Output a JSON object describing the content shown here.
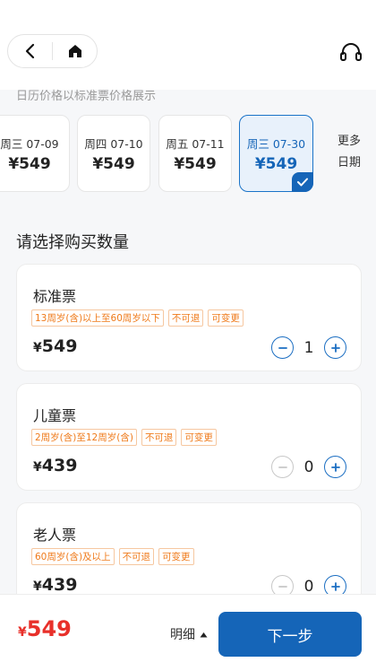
{
  "nav": {
    "back_icon": "chevron-left-icon",
    "home_icon": "home-icon",
    "service_icon": "headset-icon"
  },
  "hint": "日历价格以标准票价格展示",
  "dates": [
    {
      "day": "周三 07-09",
      "price": "¥549",
      "selected": false
    },
    {
      "day": "周四 07-10",
      "price": "¥549",
      "selected": false
    },
    {
      "day": "周五 07-11",
      "price": "¥549",
      "selected": false
    },
    {
      "day": "周三 07-30",
      "price": "¥549",
      "selected": true
    }
  ],
  "more_dates": {
    "line1": "更多",
    "line2": "日期"
  },
  "section_title": "请选择购买数量",
  "tickets": [
    {
      "name": "标准票",
      "tags": [
        "13周岁(含)以上至60周岁以下",
        "不可退",
        "可变更"
      ],
      "currency": "¥",
      "price": "549",
      "qty": "1",
      "minus_enabled": true
    },
    {
      "name": "儿童票",
      "tags": [
        "2周岁(含)至12周岁(含)",
        "不可退",
        "可变更"
      ],
      "currency": "¥",
      "price": "439",
      "qty": "0",
      "minus_enabled": false
    },
    {
      "name": "老人票",
      "tags": [
        "60周岁(含)及以上",
        "不可退",
        "可变更"
      ],
      "currency": "¥",
      "price": "439",
      "qty": "0",
      "minus_enabled": false
    }
  ],
  "footer": {
    "currency": "¥",
    "total": "549",
    "detail_label": "明细",
    "next_label": "下一步"
  },
  "colors": {
    "primary": "#1565b8",
    "price_red": "#e8302a",
    "tag_orange": "#ef7a1a"
  }
}
